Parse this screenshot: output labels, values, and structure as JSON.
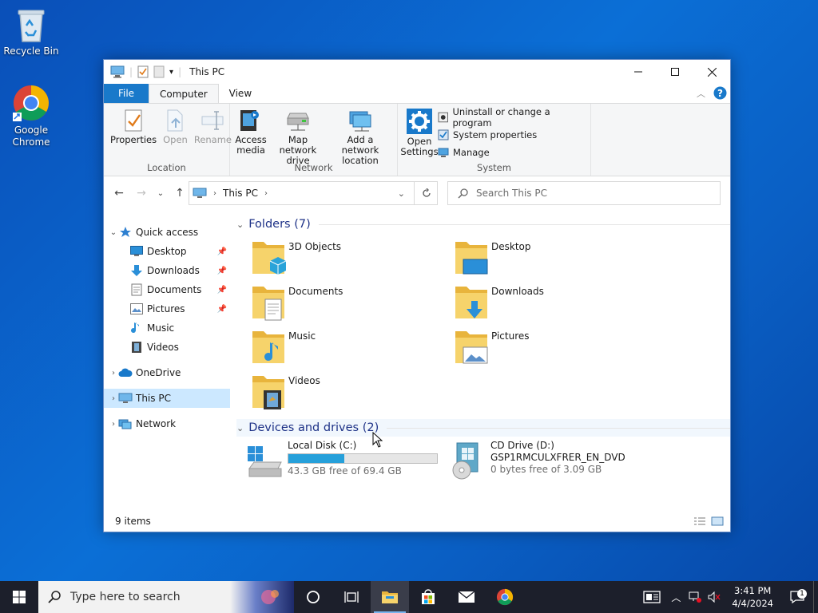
{
  "desktop": {
    "icons": [
      {
        "label": "Recycle Bin"
      },
      {
        "label": "Google Chrome"
      }
    ]
  },
  "window": {
    "title": "This PC",
    "tabs": [
      {
        "label": "File"
      },
      {
        "label": "Computer"
      },
      {
        "label": "View"
      }
    ],
    "ribbon": {
      "location_group": {
        "name": "Location",
        "properties": "Properties",
        "open": "Open",
        "rename": "Rename"
      },
      "network_group": {
        "name": "Network",
        "access_media": "Access media",
        "map_drive": "Map network drive",
        "add_location": "Add a network location"
      },
      "system_group": {
        "name": "System",
        "open_settings": "Open Settings",
        "uninstall": "Uninstall or change a program",
        "system_properties": "System properties",
        "manage": "Manage"
      }
    },
    "address": {
      "path": "This PC",
      "search_placeholder": "Search This PC"
    },
    "nav": {
      "quick_access": "Quick access",
      "quick_items": [
        {
          "label": "Desktop",
          "pinned": true
        },
        {
          "label": "Downloads",
          "pinned": true
        },
        {
          "label": "Documents",
          "pinned": true
        },
        {
          "label": "Pictures",
          "pinned": true
        },
        {
          "label": "Music",
          "pinned": false
        },
        {
          "label": "Videos",
          "pinned": false
        }
      ],
      "onedrive": "OneDrive",
      "this_pc": "This PC",
      "network": "Network"
    },
    "folders": {
      "heading": "Folders (7)",
      "items": [
        {
          "label": "3D Objects"
        },
        {
          "label": "Desktop"
        },
        {
          "label": "Documents"
        },
        {
          "label": "Downloads"
        },
        {
          "label": "Music"
        },
        {
          "label": "Pictures"
        },
        {
          "label": "Videos"
        }
      ]
    },
    "drives": {
      "heading": "Devices and drives (2)",
      "items": [
        {
          "name": "Local Disk (C:)",
          "volume": "",
          "free": "43.3 GB free of 69.4 GB",
          "used_fraction": 0.376
        },
        {
          "name": "CD Drive (D:)",
          "volume": "GSP1RMCULXFRER_EN_DVD",
          "free": "0 bytes free of 3.09 GB",
          "used_fraction": 1.0
        }
      ]
    },
    "status": {
      "items": "9 items"
    }
  },
  "taskbar": {
    "search_placeholder": "Type here to search",
    "time": "3:41 PM",
    "date": "4/4/2024",
    "notifications": "1"
  },
  "colors": {
    "accent": "#1979ca",
    "selection": "#cce8ff",
    "drive_bar": "#26a0da",
    "folder": "#f3c95b",
    "taskbar": "#1c1f2b"
  }
}
